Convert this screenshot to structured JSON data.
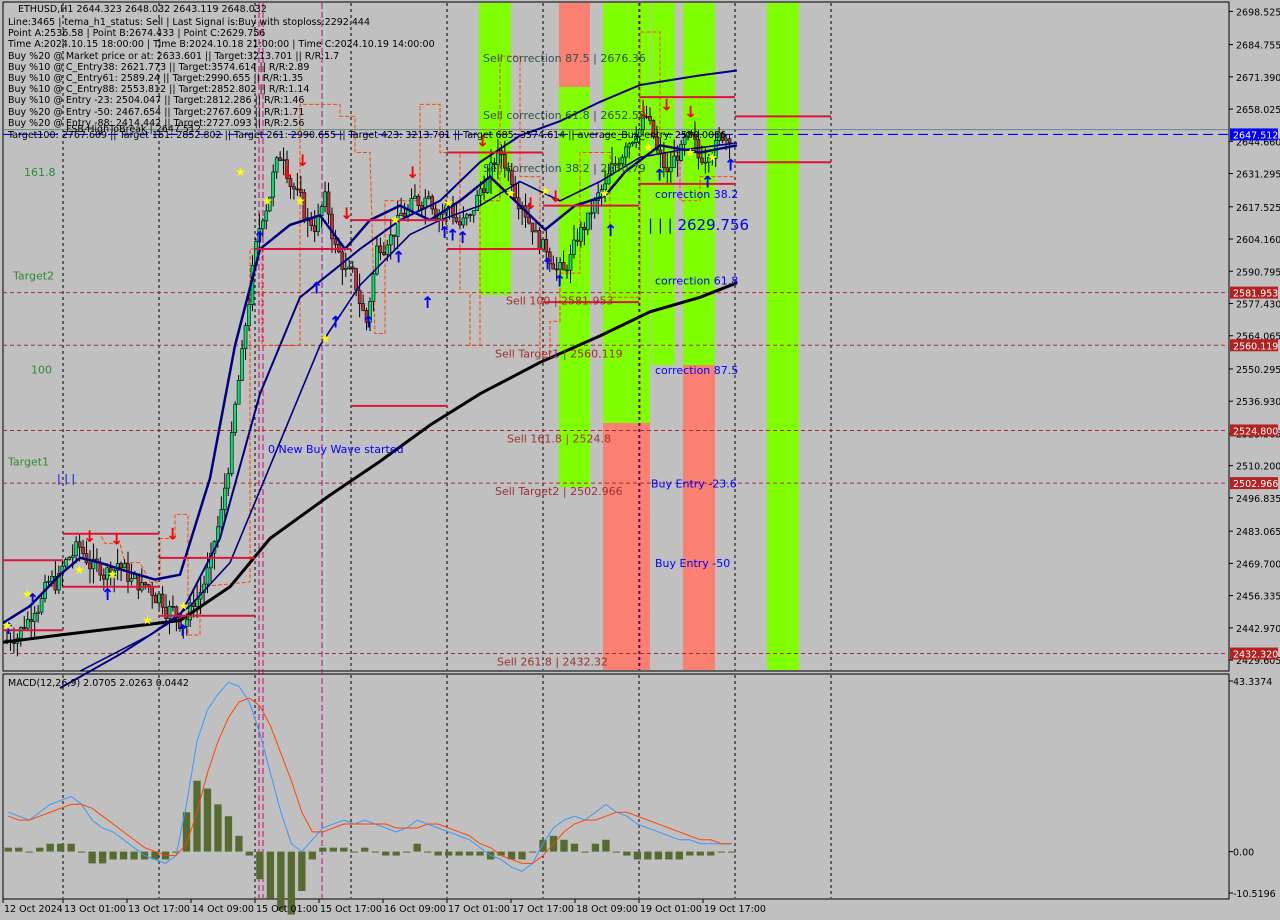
{
  "window": {
    "symbol_line": "ETHUSD,H1  2644.323 2648.032 2643.119 2648.032"
  },
  "info_lines": [
    "Line:3465 | tema_h1_status: Sell | Last Signal is:Buy with stoploss:2292.444",
    "Point A:2536.58 | Point B:2674.433 | Point C:2629.756",
    "Time A:2024.10.15 18:00:00 | Time B:2024.10.18 21:00:00 | Time C:2024.10.19 14:00:00",
    "Buy %20 @ Market price or at: 2633.601 || Target:3213.701 || R/R:1.7",
    "Buy %10 @ C_Entry38: 2621.773 || Target:3574.614 || R/R:2.89",
    "Buy %10 @ C_Entry61: 2589.24 || Target:2990.655 || R/R:1.35",
    "Buy %10 @ C_Entry88: 2553.812 || Target:2852.802 || R/R:1.14",
    "Buy %10 @ Entry -23: 2504.047 || Target:2812.286 || R/R:1.46",
    "Buy %20 @ Entry -50: 2467.654 || Target:2767.609 || R/R:1.71",
    "Buy %20 @ Entry -88: 2414.442 || Target:2727.093 || R/R:2.56",
    "Target100: 2767.609 || Target 161: 2852.802 || Target 261: 2990.655 || Target 423: 3213.701 || Target 685: 3574.614 || average_Buy_entry: 2580.0066"
  ],
  "fsb_label": "FSB-HighToBreak | 2647.512",
  "colors": {
    "background": "#c0c0c0",
    "bull_candle": "#00e070",
    "bear_candle": "#c0303a",
    "green_zone": "#80ff00",
    "red_zone": "#fa8072",
    "level_line": "#a03030",
    "dark_blue": "#000080",
    "ma_black": "#000000",
    "tag_blue": "#0000ff",
    "tag_red": "#b22222",
    "macd_line": "#3399ff",
    "signal_line": "#ff4500",
    "histogram": "#556b2f",
    "red_line": "#dc143c",
    "label_green": "#2e8b2e",
    "label_blue": "#0000ff",
    "label_brown": "#a03030"
  },
  "left_labels": [
    {
      "text": "161.8",
      "price": 2632
    },
    {
      "text": "Target2",
      "price": 2589
    },
    {
      "text": "100",
      "price": 2550
    },
    {
      "text": "Target1",
      "price": 2512
    }
  ],
  "annotations": {
    "new_buy_wave": "0 New Buy Wave started",
    "point_c_value": "| | | 2629.756",
    "point_c_small": "| | |"
  },
  "fib_labels": [
    {
      "text": "Sell correction 87.5 | 2676.36",
      "price": 2676.36,
      "color": "dark"
    },
    {
      "text": "Sell correction 61.8 | 2652.58",
      "price": 2652.58,
      "color": "dark"
    },
    {
      "text": "Sell correction 38.2 | 2630.79",
      "price": 2630.79,
      "color": "dark"
    },
    {
      "text": "Sell 100 | 2581.953",
      "price": 2581.953,
      "color": "brown"
    },
    {
      "text": "Sell Target1 | 2560.119",
      "price": 2560.119,
      "color": "brown"
    },
    {
      "text": "Sell 161.8 | 2524.8",
      "price": 2524.8,
      "color": "brown"
    },
    {
      "text": "Sell Target2 | 2502.966",
      "price": 2502.966,
      "color": "brown"
    },
    {
      "text": "Sell 261.8 | 2432.32",
      "price": 2432.32,
      "color": "brown"
    },
    {
      "text": "correction 38.2",
      "price": 2620,
      "color": "blue"
    },
    {
      "text": "correction 61.8",
      "price": 2584,
      "color": "blue"
    },
    {
      "text": "correction 87.5",
      "price": 2547,
      "color": "blue"
    },
    {
      "text": "Buy Entry -23.6",
      "price": 2500,
      "color": "blue"
    },
    {
      "text": "Buy Entry -50",
      "price": 2467,
      "color": "blue"
    }
  ],
  "chart_data": {
    "type": "candlestick",
    "title": "ETHUSD,H1",
    "price_axis": {
      "range": [
        2425,
        2702
      ],
      "ticks": [
        2698.525,
        2684.755,
        2671.39,
        2658.025,
        2644.66,
        2631.295,
        2617.525,
        2604.16,
        2590.795,
        2577.43,
        2564.065,
        2550.295,
        2536.93,
        2523.565,
        2510.2,
        2496.835,
        2483.065,
        2469.7,
        2456.335,
        2442.97,
        2429.605
      ],
      "tags": [
        {
          "value": "2647.512",
          "price": 2647.512,
          "color": "blue"
        },
        {
          "value": "2581.953",
          "price": 2581.953,
          "color": "red"
        },
        {
          "value": "2560.119",
          "price": 2560.119,
          "color": "red"
        },
        {
          "value": "2524.800",
          "price": 2524.8,
          "color": "red"
        },
        {
          "value": "2502.966",
          "price": 2502.966,
          "color": "red"
        },
        {
          "value": "2432.320",
          "price": 2432.32,
          "color": "red"
        }
      ]
    },
    "time_axis": {
      "labels": [
        "12 Oct 2024",
        "13 Oct 01:00",
        "13 Oct 17:00",
        "14 Oct 09:00",
        "15 Oct 01:00",
        "15 Oct 17:00",
        "16 Oct 09:00",
        "17 Oct 01:00",
        "17 Oct 17:00",
        "18 Oct 09:00",
        "19 Oct 01:00",
        "19 Oct 17:00"
      ]
    },
    "close_path": [
      2440,
      2445,
      2452,
      2458,
      2462,
      2470,
      2475,
      2472,
      2468,
      2466,
      2470,
      2465,
      2462,
      2460,
      2456,
      2450,
      2446,
      2450,
      2458,
      2470,
      2490,
      2520,
      2555,
      2590,
      2615,
      2630,
      2640,
      2625,
      2615,
      2610,
      2620,
      2600,
      2590,
      2585,
      2570,
      2600,
      2605,
      2610,
      2615,
      2620,
      2625,
      2615,
      2618,
      2610,
      2612,
      2625,
      2632,
      2640,
      2630,
      2620,
      2610,
      2600,
      2595,
      2590,
      2600,
      2610,
      2618,
      2625,
      2635,
      2645,
      2650,
      2655,
      2640,
      2630,
      2640,
      2645,
      2638,
      2642,
      2646,
      2648
    ],
    "hlines": [
      {
        "name": "fsb-high",
        "price": 2647.512,
        "style": "blue-dash"
      }
    ],
    "levels": [
      2581.953,
      2560.119,
      2524.8,
      2502.966,
      2432.32
    ],
    "macd": {
      "label": "MACD(12,26,9) 2.0705 2.0263 0.0442",
      "range": [
        -10.5196,
        43.3374
      ],
      "ticks": [
        "43.3374",
        "0.00",
        "-10.5196"
      ],
      "macd_values": [
        10,
        9,
        8,
        10,
        12,
        13,
        14,
        12,
        8,
        6,
        5,
        3,
        1,
        -1,
        -2,
        -3,
        -1,
        12,
        28,
        36,
        40,
        43,
        42,
        38,
        30,
        20,
        10,
        2,
        0,
        3,
        6,
        7,
        8,
        7,
        8,
        7,
        6,
        5,
        6,
        8,
        7,
        6,
        5,
        4,
        3,
        1,
        -1,
        -2,
        -4,
        -5,
        -3,
        2,
        6,
        8,
        9,
        8,
        10,
        12,
        10,
        9,
        7,
        6,
        5,
        4,
        3,
        3,
        2,
        2,
        2,
        2
      ],
      "signal_values": [
        9,
        8,
        8,
        9,
        10,
        11,
        12,
        12,
        11,
        9,
        7,
        5,
        3,
        1,
        0,
        -1,
        -1,
        2,
        10,
        20,
        28,
        34,
        38,
        39,
        37,
        32,
        25,
        18,
        10,
        5,
        5,
        6,
        7,
        7,
        7,
        7,
        7,
        6,
        6,
        6,
        7,
        7,
        6,
        5,
        4,
        2,
        1,
        -1,
        -2,
        -3,
        -3,
        -1,
        2,
        5,
        7,
        8,
        8,
        9,
        10,
        10,
        9,
        8,
        7,
        6,
        5,
        4,
        3,
        3,
        2,
        2
      ],
      "histogram": [
        1,
        1,
        0,
        1,
        2,
        2,
        2,
        0,
        -3,
        -3,
        -2,
        -2,
        -2,
        -2,
        -2,
        -2,
        0,
        10,
        18,
        16,
        12,
        9,
        4,
        -1,
        -7,
        -12,
        -15,
        -16,
        -10,
        -2,
        1,
        1,
        1,
        0,
        1,
        0,
        -1,
        -1,
        0,
        2,
        0,
        -1,
        -1,
        -1,
        -1,
        -1,
        -2,
        -1,
        -2,
        -2,
        0,
        3,
        4,
        3,
        2,
        0,
        2,
        3,
        0,
        -1,
        -2,
        -2,
        -2,
        -2,
        -2,
        -1,
        -1,
        -1,
        0,
        0
      ]
    }
  }
}
